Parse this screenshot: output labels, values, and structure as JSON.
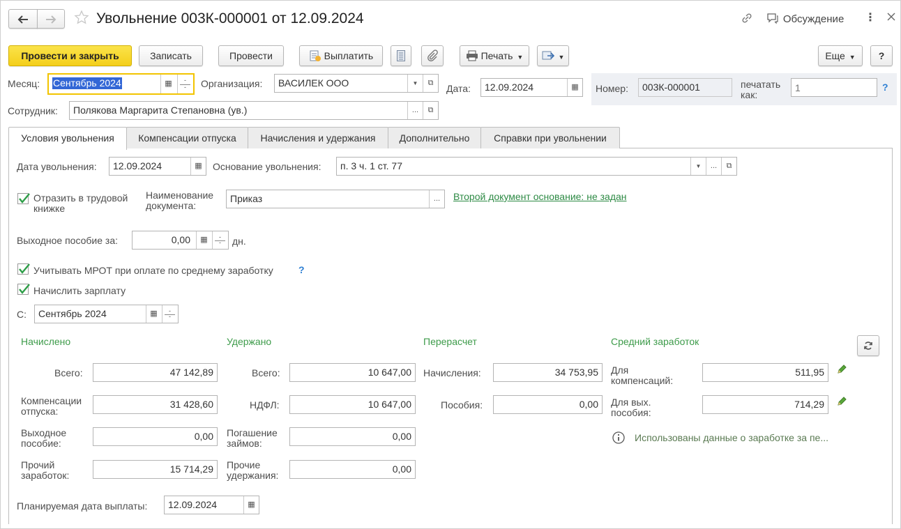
{
  "window": {
    "title": "Увольнение 003К-000001 от 12.09.2024",
    "discussion_label": "Обсуждение"
  },
  "toolbar": {
    "post_close": "Провести и закрыть",
    "save": "Записать",
    "post": "Провести",
    "pay": "Выплатить",
    "print": "Печать",
    "more": "Еще",
    "help": "?"
  },
  "header": {
    "month_label": "Месяц:",
    "month_value": "Сентябрь 2024",
    "org_label": "Организация:",
    "org_value": "ВАСИЛЕК ООО",
    "date_label": "Дата:",
    "date_value": "12.09.2024",
    "number_label": "Номер:",
    "number_value": "003К-000001",
    "print_as_label": "печатать как:",
    "print_as_placeholder": "1",
    "employee_label": "Сотрудник:",
    "employee_value": "Полякова Маргарита Степановна (ув.)"
  },
  "tabs": [
    {
      "label": "Условия увольнения",
      "active": true
    },
    {
      "label": "Компенсации отпуска",
      "active": false
    },
    {
      "label": "Начисления и удержания",
      "active": false
    },
    {
      "label": "Дополнительно",
      "active": false
    },
    {
      "label": "Справки при увольнении",
      "active": false
    }
  ],
  "conditions": {
    "dismissal_date_label": "Дата увольнения:",
    "dismissal_date_value": "12.09.2024",
    "reason_label": "Основание увольнения:",
    "reason_value": "п. 3 ч. 1 ст. 77",
    "reflect_label": "Отразить в трудовой книжке",
    "reflect_checked": true,
    "doc_name_label": "Наименование документа:",
    "doc_name_value": "Приказ",
    "second_doc_link": "Второй документ основание: не задан",
    "severance_label": "Выходное пособие за:",
    "severance_value": "0,00",
    "severance_unit": "дн.",
    "mrot_label": "Учитывать МРОТ при оплате по среднему заработку",
    "mrot_checked": true,
    "accrue_label": "Начислить зарплату",
    "accrue_checked": true,
    "from_label": "С:",
    "from_value": "Сентябрь 2024",
    "planned_date_label": "Планируемая дата выплаты:",
    "planned_date_value": "12.09.2024"
  },
  "summary": {
    "accrued": {
      "title": "Начислено",
      "total_label": "Всего:",
      "total": "47 142,89",
      "vacation_label": "Компенсации отпуска:",
      "vacation": "31 428,60",
      "severance_label": "Выходное пособие:",
      "severance": "0,00",
      "other_label": "Прочий заработок:",
      "other": "15 714,29"
    },
    "withheld": {
      "title": "Удержано",
      "total_label": "Всего:",
      "total": "10 647,00",
      "ndfl_label": "НДФЛ:",
      "ndfl": "10 647,00",
      "loans_label": "Погашение займов:",
      "loans": "0,00",
      "other_label": "Прочие удержания:",
      "other": "0,00"
    },
    "recalc": {
      "title": "Перерасчет",
      "accruals_label": "Начисления:",
      "accruals": "34 753,95",
      "benefits_label": "Пособия:",
      "benefits": "0,00"
    },
    "avg": {
      "title": "Средний заработок",
      "comp_label": "Для компенсаций:",
      "comp": "511,95",
      "sev_label": "Для вых. пособия:",
      "sev": "714,29",
      "info": "Использованы данные о заработке за пе..."
    }
  },
  "colors": {
    "accent_yellow": "#f4cf1b",
    "section_green": "#3d9b4a",
    "link_green": "#2d8a44",
    "help_blue": "#2d7fd3"
  }
}
